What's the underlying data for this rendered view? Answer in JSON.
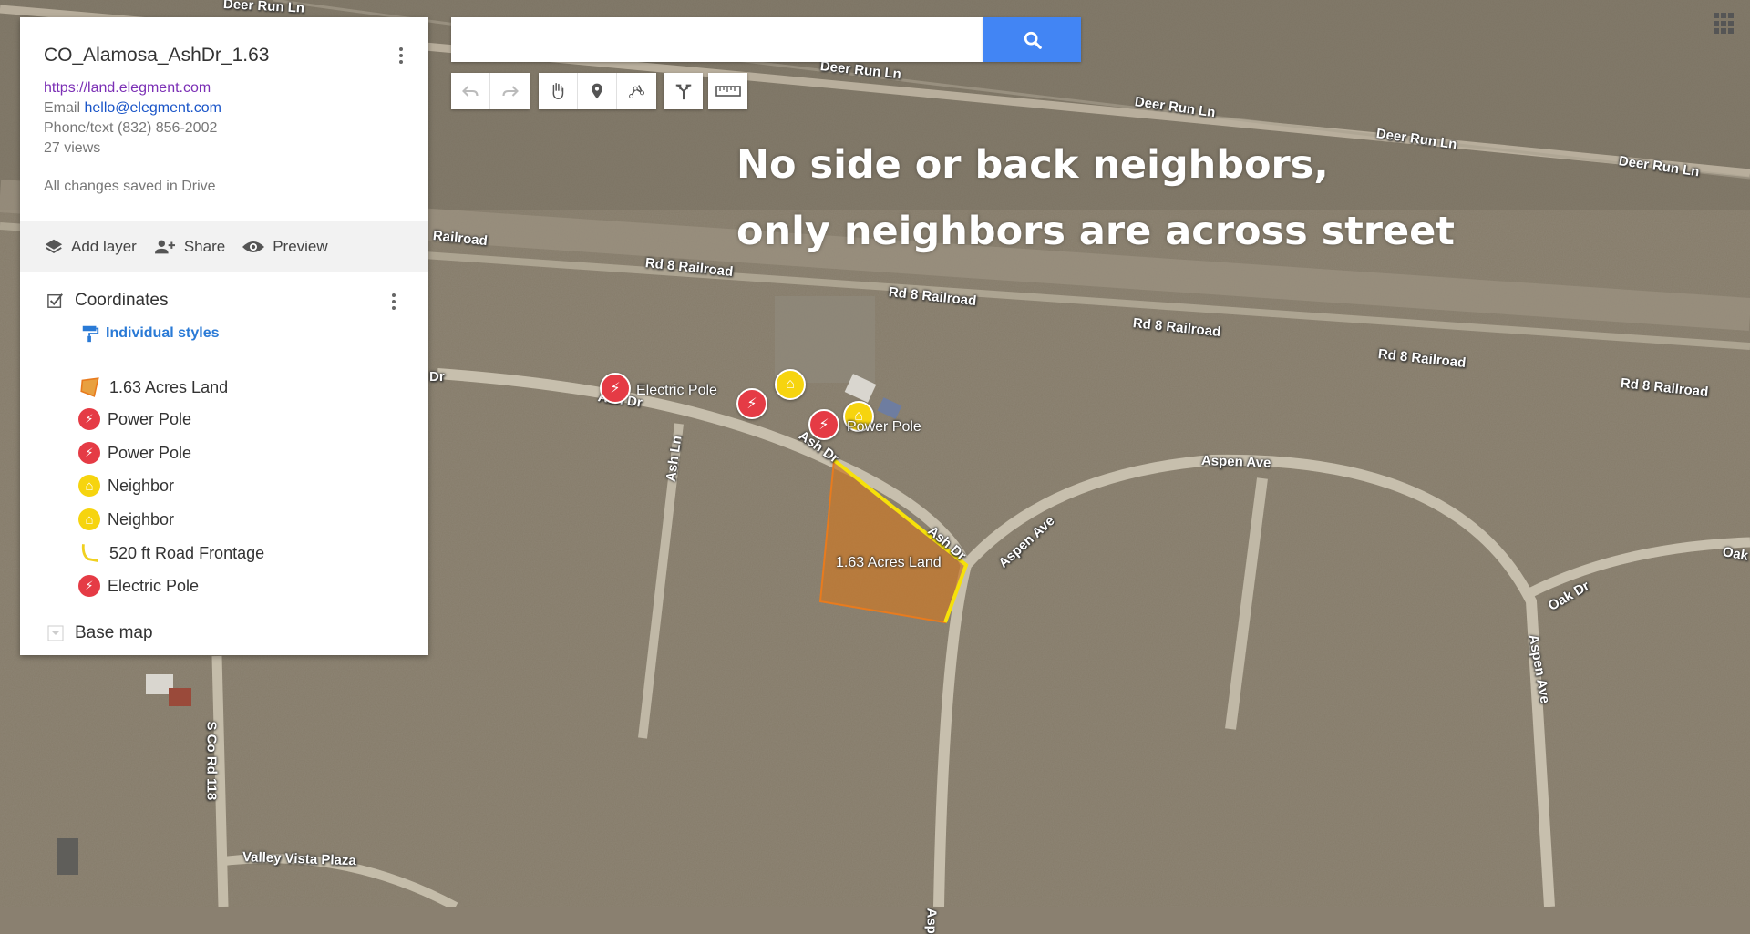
{
  "map": {
    "overlay_line1": "No side or back neighbors,",
    "overlay_line2": "only neighbors are across street",
    "road_labels": {
      "deer1": "Deer Run Ln",
      "deer2": "Deer Run Ln",
      "deer3": "Deer Run Ln",
      "deer4": "Deer Run Ln",
      "deer5": "Deer Run Ln",
      "rail1": "Railroad",
      "rail2": "Rd 8 Railroad",
      "rail3": "Rd 8 Railroad",
      "rail4": "Rd 8 Railroad",
      "rail5": "Rd 8 Railroad",
      "rail6": "Rd 8 Railroad",
      "ash_dr1": "Ash Dr",
      "ash_dr2": "Ash Dr",
      "ash_dr3": "Ash Dr",
      "ash_ln": "Ash Ln",
      "aspen1": "Aspen Ave",
      "aspen2": "Aspen Ave",
      "aspen3": "Aspen Ave",
      "aspen4": "Asp",
      "oak1": "Oak Dr",
      "oak2": "Oak",
      "co_rd": "S Co Rd 118",
      "valley": "Valley Vista Plaza",
      "dr_left": "Dr"
    },
    "marker_labels": {
      "electric_pole": "Electric Pole",
      "power_pole": "Power Pole",
      "parcel": "1.63 Acres Land"
    },
    "colors": {
      "parcel_fill": "#c9782a",
      "parcel_edge": "#e87b1e",
      "frontage": "#f6e10a",
      "marker_red": "#e53b45",
      "marker_yellow": "#f6d40f"
    }
  },
  "search": {
    "value": "",
    "placeholder": "",
    "button_icon": "search-icon"
  },
  "toolbar": {
    "undo": "undo-icon",
    "redo": "redo-icon",
    "hand": "hand-icon",
    "marker": "marker-icon",
    "line": "draw-line-icon",
    "directions": "directions-icon",
    "ruler": "ruler-icon"
  },
  "panel": {
    "title": "CO_Alamosa_AshDr_1.63",
    "url": "https://land.elegment.com",
    "email_label": "Email",
    "email": "hello@elegment.com",
    "phone": "Phone/text (832) 856-2002",
    "views": "27 views",
    "saved": "All changes saved in Drive",
    "actions": {
      "add_layer": "Add layer",
      "share": "Share",
      "preview": "Preview"
    },
    "layer": {
      "title": "Coordinates",
      "styles": "Individual styles",
      "features": [
        {
          "label": "1.63 Acres Land",
          "icon": "polygon-icon"
        },
        {
          "label": "Power Pole",
          "icon": "power-pole-icon"
        },
        {
          "label": "Power Pole",
          "icon": "power-pole-icon"
        },
        {
          "label": "Neighbor",
          "icon": "house-icon"
        },
        {
          "label": "Neighbor",
          "icon": "house-icon"
        },
        {
          "label": "520 ft Road Frontage",
          "icon": "line-icon"
        },
        {
          "label": "Electric Pole",
          "icon": "power-pole-icon"
        }
      ]
    },
    "basemap": "Base map"
  }
}
